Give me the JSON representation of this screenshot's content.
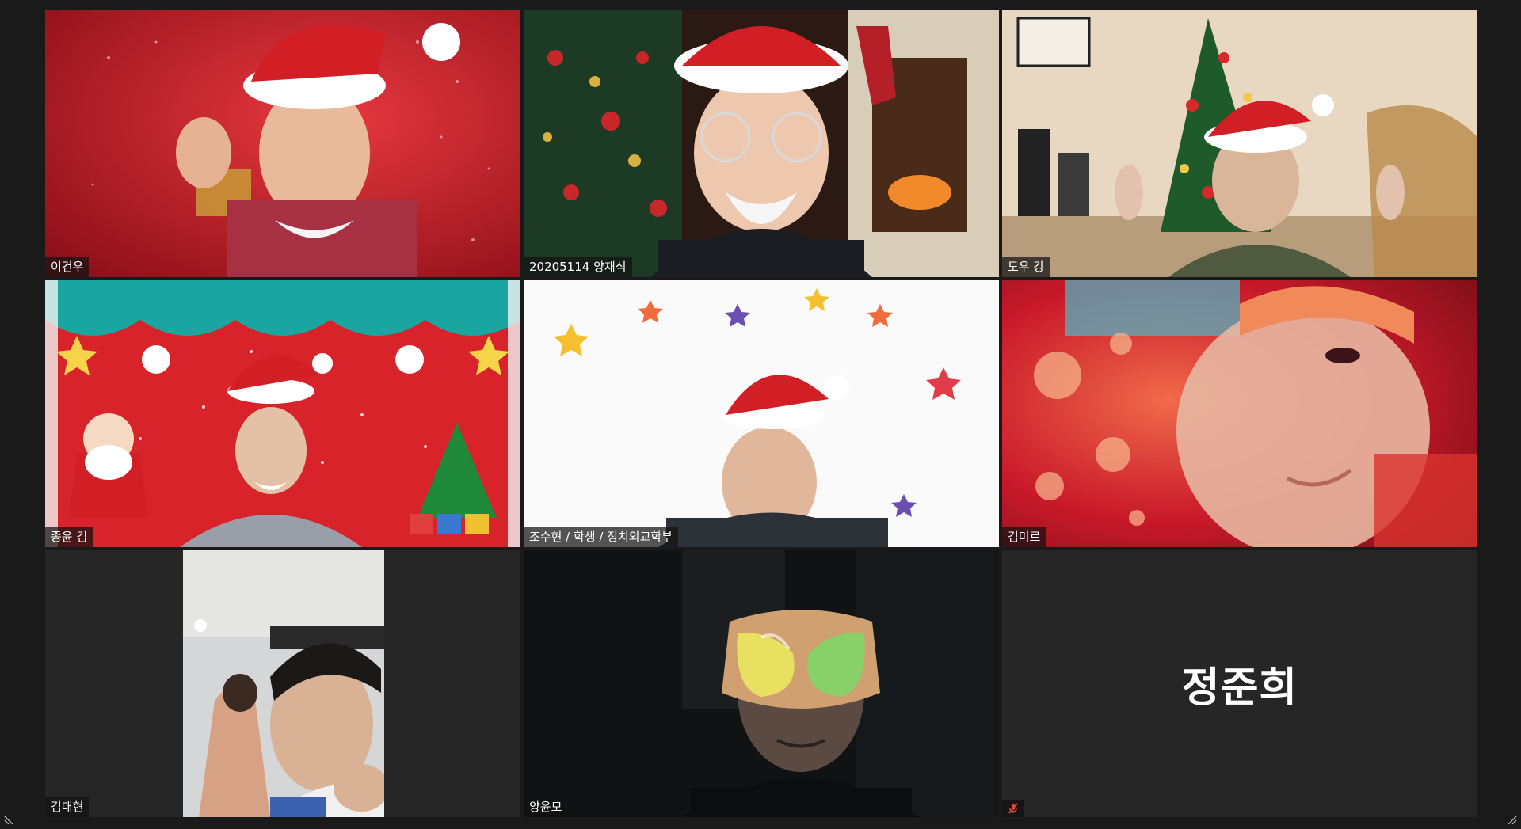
{
  "app": {
    "view": "gallery"
  },
  "colors": {
    "background": "#1a1a1a",
    "tile_background": "#262626",
    "active_speaker_border": "#e7e04f",
    "muted_icon": "#e0463b",
    "name_text": "#ffffff"
  },
  "participants": [
    {
      "name": "이건우",
      "video": true,
      "active": false,
      "muted": false
    },
    {
      "name": "20205114 양재식",
      "video": true,
      "active": false,
      "muted": false
    },
    {
      "name": "도우 강",
      "video": true,
      "active": false,
      "muted": false
    },
    {
      "name": "종윤 김",
      "video": true,
      "active": true,
      "muted": false
    },
    {
      "name": "조수현 / 학생 / 정치외교학부",
      "video": true,
      "active": false,
      "muted": false
    },
    {
      "name": "김미르",
      "video": true,
      "active": false,
      "muted": false
    },
    {
      "name": "김대현",
      "video": true,
      "active": false,
      "muted": false
    },
    {
      "name": "양윤모",
      "video": true,
      "active": false,
      "muted": false
    },
    {
      "name": "정준희",
      "video": false,
      "active": false,
      "muted": true
    }
  ],
  "icons": {
    "muted": "mic-muted-icon",
    "resize": "resize-handle-icon"
  }
}
